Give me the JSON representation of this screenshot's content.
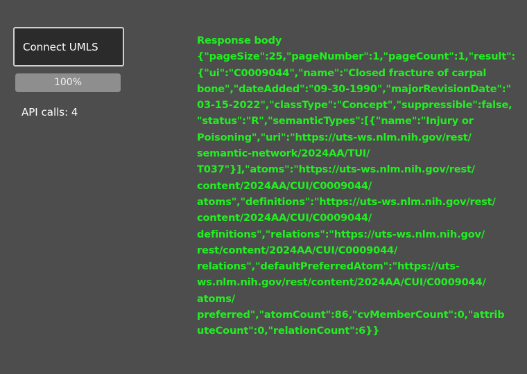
{
  "connect_button": {
    "label": "Connect UMLS"
  },
  "progress": {
    "label": "100%",
    "value": 100
  },
  "api_calls": "API calls: 4",
  "response": {
    "title": "Response body",
    "lines": [
      "{\"pageSize\":25,\"pageNumber\":1,\"pageCount\":1,\"result\":",
      "{\"ui\":\"C0009044\",\"name\":\"Closed fracture of carpal",
      "bone\",\"dateAdded\":\"09-30-1990\",\"majorRevisionDate\":\"",
      "03-15-2022\",\"classType\":\"Concept\",\"suppressible\":false,",
      "\"status\":\"R\",\"semanticTypes\":[{\"name\":\"Injury or",
      "Poisoning\",\"uri\":\"https://uts-ws.nlm.nih.gov/rest/",
      "semantic-network/2024AA/TUI/",
      "T037\"}],\"atoms\":\"https://uts-ws.nlm.nih.gov/rest/",
      "content/2024AA/CUI/C0009044/",
      "atoms\",\"definitions\":\"https://uts-ws.nlm.nih.gov/rest/",
      "content/2024AA/CUI/C0009044/",
      "definitions\",\"relations\":\"https://uts-ws.nlm.nih.gov/",
      "rest/content/2024AA/CUI/C0009044/",
      "relations\",\"defaultPreferredAtom\":\"https://uts-",
      "ws.nlm.nih.gov/rest/content/2024AA/CUI/C0009044/",
      "atoms/",
      "preferred\",\"atomCount\":86,\"cvMemberCount\":0,\"attrib",
      "uteCount\":0,\"relationCount\":6}}"
    ]
  }
}
